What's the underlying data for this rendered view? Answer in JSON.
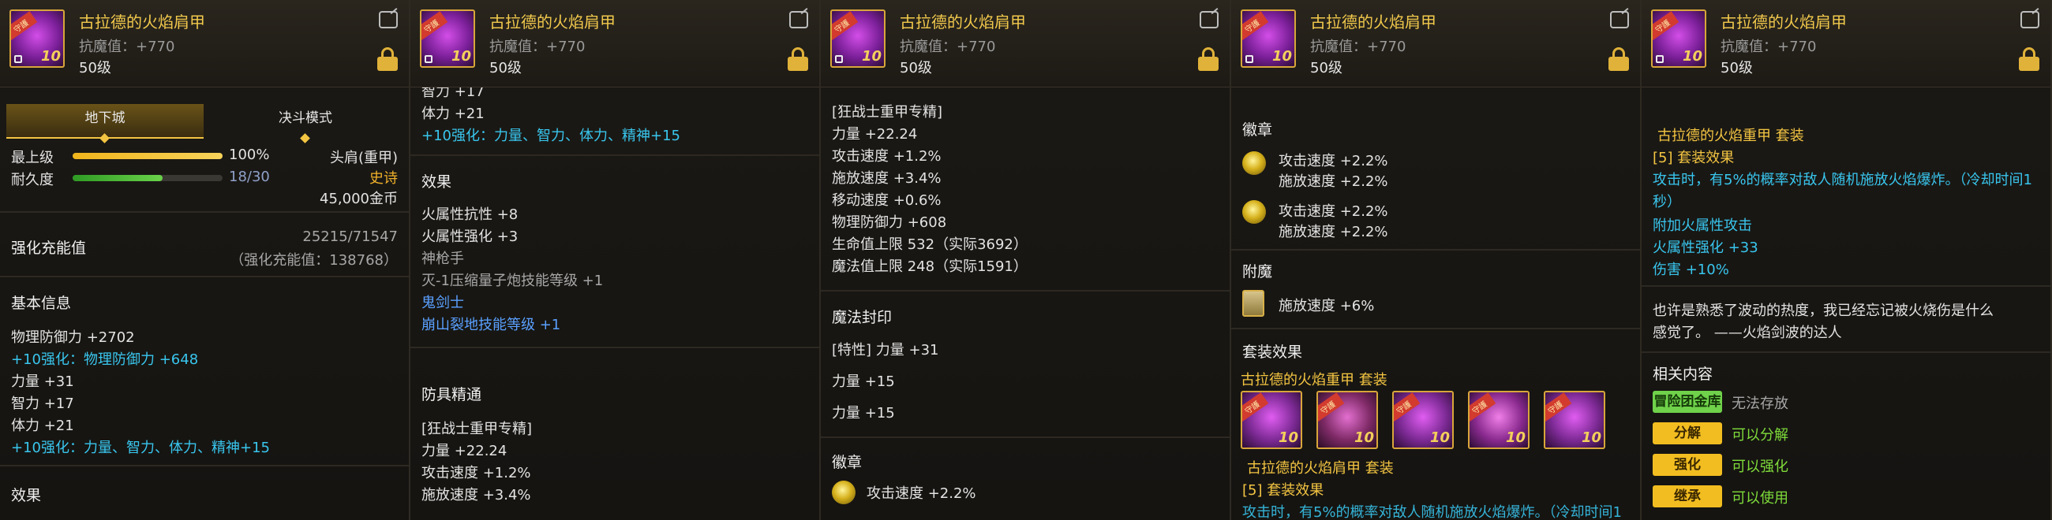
{
  "item": {
    "name": "古拉德的火焰肩甲",
    "resist": "抗魔值：+770",
    "level": "50级",
    "icon_tag": "守護",
    "icon_plus": "10"
  },
  "panel1": {
    "tabs": [
      "地下城",
      "决斗模式"
    ],
    "max_level_label": "最上级",
    "max_level_value": "100%",
    "durability_label": "耐久度",
    "durability_value": "18/30",
    "durability_fraction": 0.6,
    "slot": "头肩(重甲)",
    "rarity": "史诗",
    "price": "45,000金币",
    "reinforce_label": "强化充能值",
    "reinforce_value": "25215/71547",
    "reinforce_sub": "（强化充能值：138768）",
    "basic_info": "基本信息",
    "stats": [
      "物理防御力 +2702",
      "+10强化：物理防御力 +648",
      "力量 +31",
      "智力 +17",
      "体力 +21",
      "+10强化：力量、智力、体力、精神+15"
    ],
    "effect_title": "效果"
  },
  "panel2": {
    "top_cut": "智力 +17",
    "stat1": "体力 +21",
    "stat2": "+10强化：力量、智力、体力、精神+15",
    "effect_title": "效果",
    "effects": [
      "火属性抗性 +8",
      "火属性强化 +3",
      "神枪手",
      "灭-1压缩量子炮技能等级 +1",
      "鬼剑士",
      "崩山裂地技能等级 +1"
    ],
    "mastery_title": "防具精通",
    "mastery_sub": "[狂战士重甲专精]",
    "mastery_stats": [
      "力量 +22.24",
      "攻击速度 +1.2%",
      "施放速度 +3.4%"
    ]
  },
  "panel3": {
    "mastery_sub": "[狂战士重甲专精]",
    "mastery_stats": [
      "力量 +22.24",
      "攻击速度 +1.2%",
      "施放速度 +3.4%",
      "移动速度 +0.6%",
      "物理防御力 +608",
      "生命值上限 532（实际3692）",
      "魔法值上限 248（实际1591）"
    ],
    "seal_title": "魔法封印",
    "seal_lines": [
      "[特性] 力量 +31",
      "力量 +15",
      "力量 +15"
    ],
    "emblem_title": "徽章",
    "emblem_line": "攻击速度 +2.2%"
  },
  "panel4": {
    "emblem_title": "徽章",
    "emblems": [
      [
        "攻击速度 +2.2%",
        "施放速度 +2.2%"
      ],
      [
        "攻击速度 +2.2%",
        "施放速度 +2.2%"
      ]
    ],
    "enchant_title": "附魔",
    "enchant_line": "施放速度 +6%",
    "set_title": "套装效果",
    "set_name": "古拉德的火焰重甲",
    "set_word": "套装",
    "set_item_name": "古拉德的火焰肩甲",
    "set_effect_count": "[5] 套装效果",
    "cut_line": "攻击时，有5%的概率对敌人随机施放火焰爆炸。（冷却时间1"
  },
  "panel5": {
    "set_item_name": "古拉德的火焰重甲",
    "set_word": "套装",
    "set_effect_count": "[5] 套装效果",
    "set_lines": [
      "攻击时，有5%的概率对敌人随机施放火焰爆炸。（冷却时间1",
      "秒）",
      "附加火属性攻击",
      "火属性强化 +33",
      "伤害 +10%"
    ],
    "flavor": [
      "也许是熟悉了波动的热度，我已经忘记被火烧伤是什么",
      "感觉了。 ——火焰剑波的达人"
    ],
    "related_title": "相关内容",
    "related": [
      {
        "btn": "冒险团金库",
        "text": "无法存放"
      },
      {
        "btn": "分解",
        "text": "可以分解"
      },
      {
        "btn": "强化",
        "text": "可以强化"
      },
      {
        "btn": "继承",
        "text": "可以使用"
      }
    ]
  },
  "colors": {
    "gold": "#f4c542",
    "cyan": "#39c6ee",
    "green": "#7fdc3a",
    "epic": "#f4c542"
  }
}
